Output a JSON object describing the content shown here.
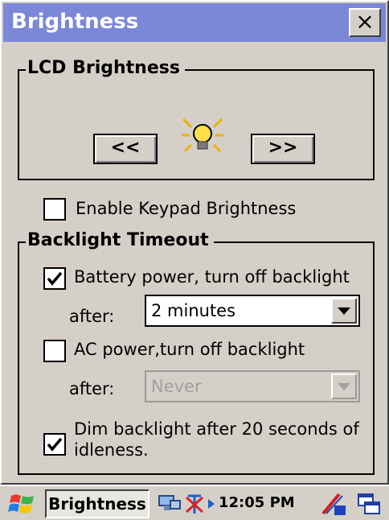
{
  "window": {
    "title": "Brightness",
    "close_label": "×"
  },
  "lcd": {
    "group_label": "LCD Brightness",
    "decrease_label": "<<",
    "increase_label": ">>"
  },
  "keypad": {
    "label": "Enable Keypad Brightness",
    "checked": false
  },
  "backlight": {
    "group_label": "Backlight Timeout",
    "battery": {
      "label": "Battery power, turn off backlight",
      "checked": true,
      "after_label": "after:",
      "value": "2 minutes"
    },
    "ac": {
      "label": "AC  power,turn off backlight",
      "checked": false,
      "after_label": "after:",
      "value": "Never"
    },
    "dim": {
      "line1": "Dim backlight after 20 seconds of",
      "line2": "idleness.",
      "checked": true
    }
  },
  "taskbar": {
    "app_label": "Brightness",
    "clock": "12:05 PM"
  },
  "colors": {
    "title_bar": "#7b88d8",
    "face": "#d4d0c8"
  }
}
